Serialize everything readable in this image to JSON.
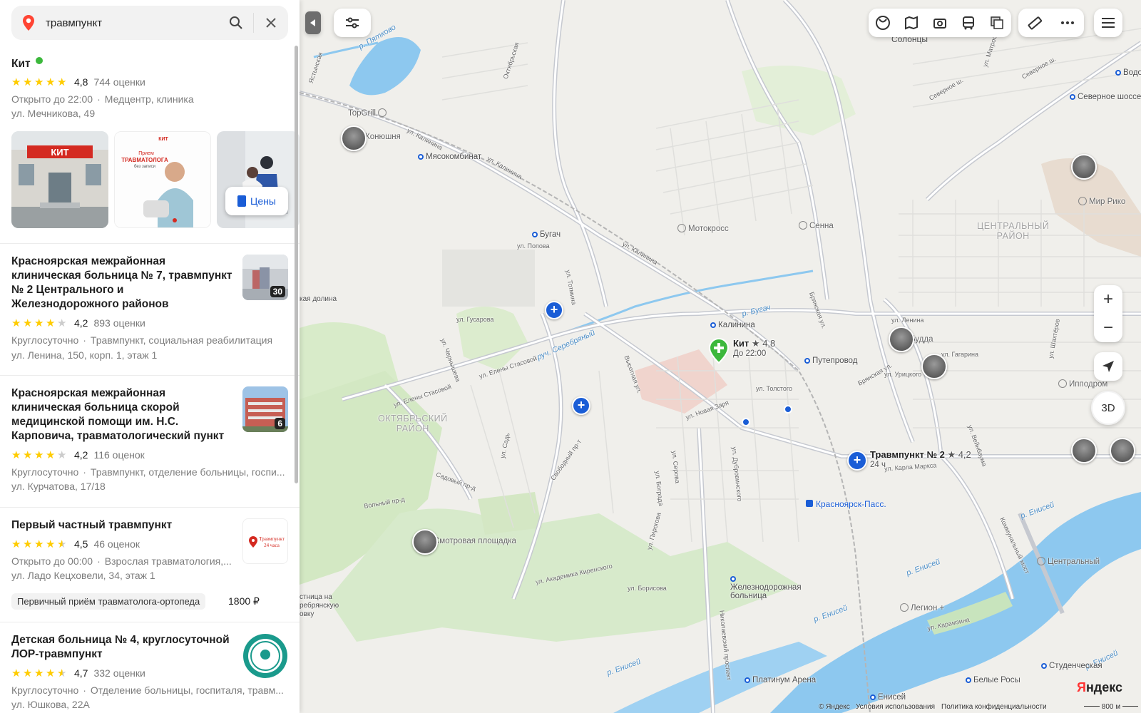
{
  "search": {
    "query": "травмпункт",
    "search_icon": "search-icon",
    "clear_icon": "close-icon"
  },
  "results": [
    {
      "title": "Кит",
      "verified": true,
      "rating": "4,8",
      "stars": 4.8,
      "reviews": "744 оценки",
      "status": "Открыто до 22:00",
      "category": "Медцентр, клиника",
      "address": "ул. Мечникова, 49",
      "photos": [
        "clinic-facade-photo",
        "trauma-doctor-poster-photo",
        "clinic-interior-photo"
      ],
      "poster_text": [
        "КИТ",
        "Прием",
        "ТРАВМАТОЛОГА",
        "без записи"
      ],
      "prices_button": "Цены"
    },
    {
      "title_lines": [
        "Красноярская межрайонная",
        "клиническая больница № 7, травмпункт",
        "№ 2 Центрального и",
        "Железнодорожного районов"
      ],
      "rating": "4,2",
      "stars": 4.2,
      "reviews": "893 оценки",
      "status": "Круглосуточно",
      "category": "Травмпункт, социальная реабилитация",
      "address": "ул. Ленина, 150, корп. 1, этаж 1",
      "photo_count": "30"
    },
    {
      "title_lines": [
        "Красноярская межрайонная",
        "клиническая больница скорой",
        "медицинской помощи им. Н.С.",
        "Карповича, травматологический пункт"
      ],
      "rating": "4,2",
      "stars": 4.2,
      "reviews": "116 оценок",
      "status": "Круглосуточно",
      "category": "Травмпункт, отделение больницы, госпи...",
      "address": "ул. Курчатова, 17/18",
      "photo_count": "6"
    },
    {
      "title": "Первый частный травмпункт",
      "rating": "4,5",
      "stars": 4.5,
      "reviews": "46 оценок",
      "status": "Открыто до 00:00",
      "category": "Взрослая травматология,...",
      "address": "ул. Ладо Кецховели, 34, этаж 1",
      "logo_text": [
        "Травмпункт",
        "24 часа"
      ],
      "service": "Первичный приём травматолога-ортопеда",
      "service_price": "1800 ₽"
    },
    {
      "title_lines": [
        "Детская больница № 4, круглосуточной",
        "ЛОР-травмпункт"
      ],
      "rating": "4,7",
      "stars": 4.7,
      "reviews": "332 оценки",
      "status": "Круглосуточно",
      "category": "Отделение больницы, госпиталя, травм...",
      "address": "ул. Юшкова, 22А"
    }
  ],
  "map": {
    "toolbar_icons": [
      "collapse-panel-icon",
      "filters-icon",
      "panorama-icon",
      "layers-map-icon",
      "camera-icon",
      "bus-icon",
      "map-layers-icon",
      "ruler-icon",
      "more-icon",
      "menu-icon"
    ],
    "zoom_in": "+",
    "zoom_out": "−",
    "mode_3d": "3D",
    "markers": [
      {
        "name": "Кит",
        "rating": "★ 4,8",
        "hours": "До 22:00"
      },
      {
        "name": "Травмпункт № 2",
        "rating": "★ 4,2",
        "hours": "24 ч"
      }
    ],
    "places": [
      "Солонцы",
      "Водо",
      "Северное шоссе",
      "Мир Рико",
      "TopGrill",
      "Конюшня",
      "Мясокомбинат",
      "Бугач",
      "Мотокросс",
      "Сенна",
      "Калинина",
      "Будда",
      "Путепровод",
      "Ипподром",
      "Красноярск-Пасс.",
      "Смотровая площадка",
      "Железнодорожная больница",
      "Центральный",
      "Легион +",
      "Студенческая",
      "Платинум Арена",
      "Енисей",
      "Белые Росы"
    ],
    "districts": [
      "ОКТЯБРЬСКИЙ\nРАЙОН",
      "ЦЕНТРАЛЬНЫЙ\nРАЙОН"
    ],
    "rivers": [
      "р. Пятково",
      "р. Бугач",
      "руч. Серебряный",
      "р. Енисей",
      "р. Енисей",
      "р. Енисей",
      "р. Енисей",
      "р. Енисей"
    ],
    "streets": [
      "ул. Калинина",
      "ул. Калинина",
      "ул. Калинина",
      "ул. Елены Стасовой",
      "ул. Елены Стасовой",
      "ул. Гусарова",
      "ул. Попова",
      "ул. Тотмина",
      "Высотная ул.",
      "ул. Карла Маркса",
      "ул. Академика Киренского",
      "ул. Борисова",
      "Свободный пр-т",
      "Николаевский проспект",
      "Брянская ул.",
      "Брянская ул.",
      "ул. Ленина",
      "ул. Гагарина",
      "ул. Толстого",
      "ул. Новая Заря",
      "Северное ш.",
      "Северное ш.",
      "ул. Шахтёров",
      "ул. Вейнбаума",
      "Коммунальный мост",
      "ул. Урицкого",
      "ул. Пирогова",
      "Садовый пр-д",
      "Вольный пр-д",
      "ул. Садь",
      "ул. Чернышева",
      "ул. Серова",
      "ул. Бограда",
      "ул. Дубровинского",
      "ул. Карамзина",
      "ул. Матросова",
      "Октябрьская",
      "Ястынская"
    ],
    "side_labels": [
      "кая долина",
      "стница на",
      "ребрянскую",
      "овку"
    ],
    "brand": "Яндекс",
    "footer": [
      "© Яндекс",
      "Условия использования",
      "Политика конфиденциальности"
    ],
    "scale": "800 м"
  },
  "colors": {
    "accent": "#1a5dd6",
    "star": "#ffcc00",
    "water": "#8dc8ef",
    "park": "#d6ebc9",
    "green_marker": "#3cb83c"
  }
}
